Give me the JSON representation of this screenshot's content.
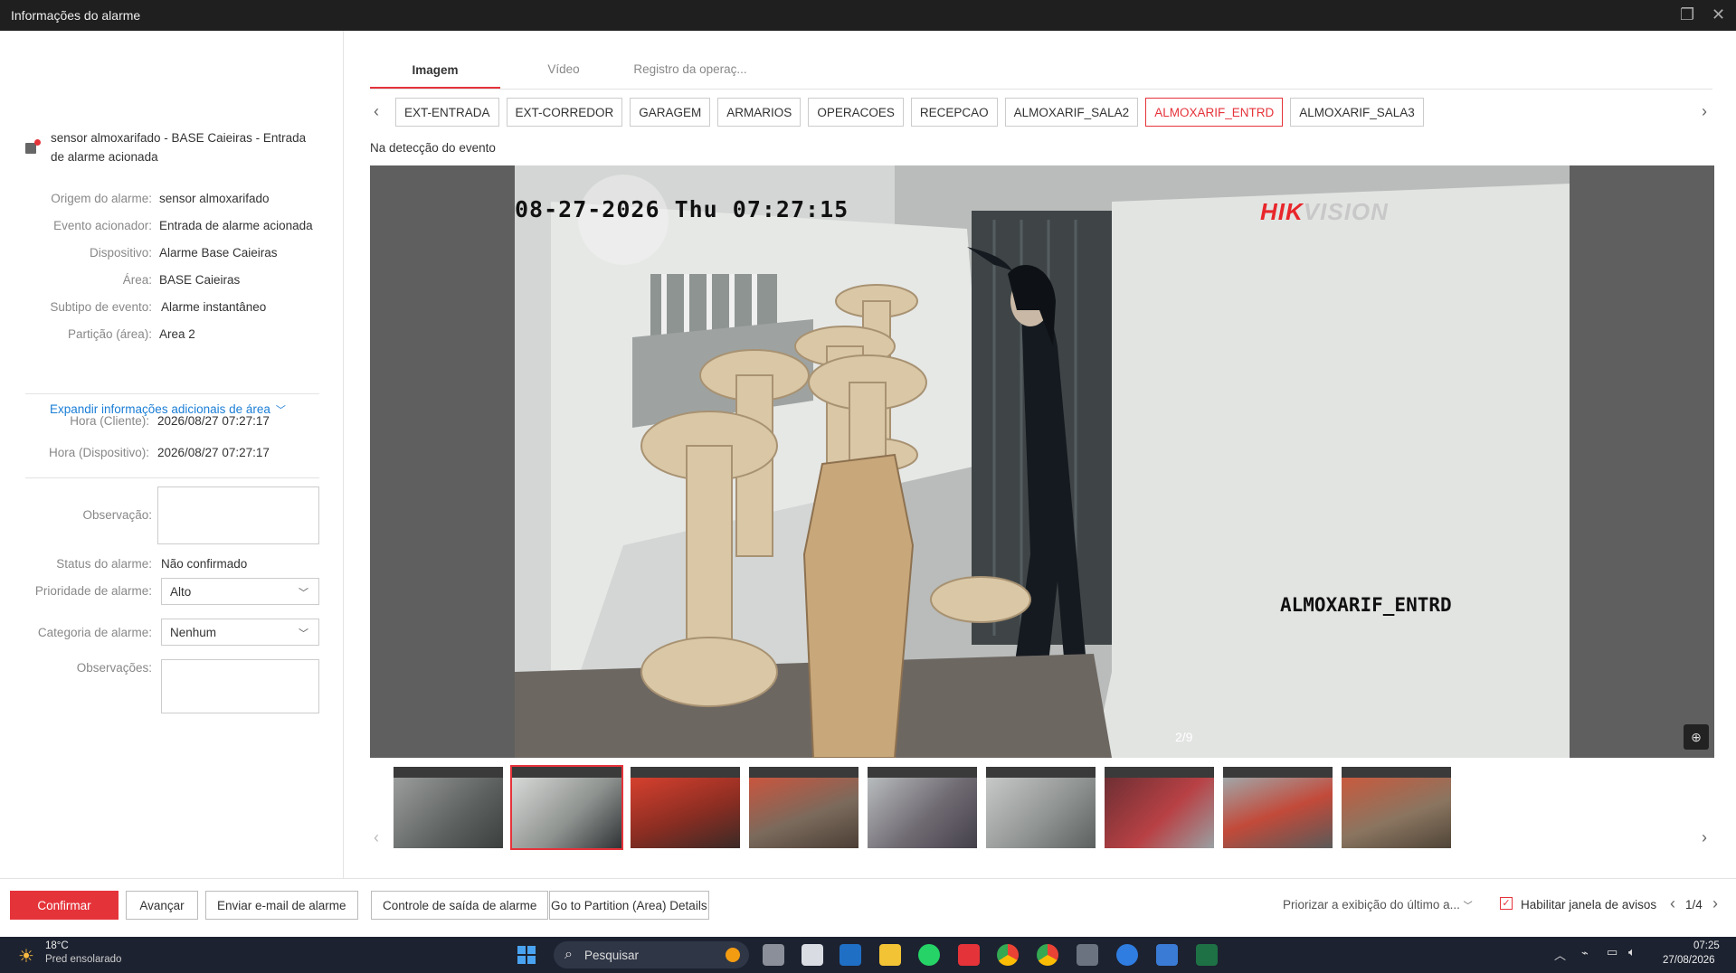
{
  "window": {
    "title": "Informações do alarme"
  },
  "source": {
    "text": "sensor almoxarifado  - BASE Caieiras - Entrada de alarme acionada"
  },
  "info": [
    {
      "label": "Origem do alarme:",
      "value": "sensor almoxarifado"
    },
    {
      "label": "Evento acionador:",
      "value": "Entrada de alarme acionada"
    },
    {
      "label": "Dispositivo:",
      "value": "Alarme Base Caieiras"
    },
    {
      "label": "Área:",
      "value": "BASE Caieiras"
    },
    {
      "label": "Subtipo de evento:",
      "value": "Alarme instantâneo"
    },
    {
      "label": "Partição (área):",
      "value": "Area 2"
    }
  ],
  "expand": {
    "label": "Expandir informações adicionais de área"
  },
  "times": [
    {
      "label": "Hora (Cliente):",
      "value": "2026/08/27 07:27:17"
    },
    {
      "label": "Hora (Dispositivo):",
      "value": "2026/08/27 07:27:17"
    }
  ],
  "form": {
    "observacao_label": "Observação:",
    "status_label": "Status do alarme:",
    "status_value": "Não confirmado",
    "priority_label": "Prioridade de alarme:",
    "priority_value": "Alto",
    "category_label": "Categoria de alarme:",
    "category_value": "Nenhum",
    "observacoes_label": "Observações:"
  },
  "tabs": [
    "Imagem",
    "Vídeo",
    "Registro da operaç..."
  ],
  "cameras": [
    "EXT-ENTRADA",
    "EXT-CORREDOR",
    "GARAGEM",
    "ARMARIOS",
    "OPERACOES",
    "RECEPCAO",
    "ALMOXARIF_SALA2",
    "ALMOXARIF_ENTRD",
    "ALMOXARIF_SALA3"
  ],
  "active_camera_index": 7,
  "detection_label": "Na detecção do evento",
  "viewer": {
    "osd_time": "08-27-2026 Thu 07:27:15",
    "brand_hik": "HIK",
    "brand_vision": "VISION",
    "osd_camera": "ALMOXARIF_ENTRD",
    "pager": "2/9"
  },
  "thumbnail_count": 9,
  "active_thumbnail_index": 1,
  "buttons": {
    "confirm": "Confirmar",
    "next": "Avançar",
    "email": "Enviar e-mail de alarme",
    "output": "Controle de saída de alarme",
    "partition": "Go to Partition (Area) Details"
  },
  "bottom": {
    "priorizar": "Priorizar a exibição do último a...",
    "habilitar": "Habilitar janela de avisos",
    "page": "1/4"
  },
  "taskbar": {
    "weather_temp": "18°C",
    "weather_desc": "Pred ensolarado",
    "search": "Pesquisar",
    "time": "07:25",
    "date": "27/08/2026"
  },
  "colors": {
    "accent": "#e5333a",
    "link": "#1a7ed6"
  }
}
